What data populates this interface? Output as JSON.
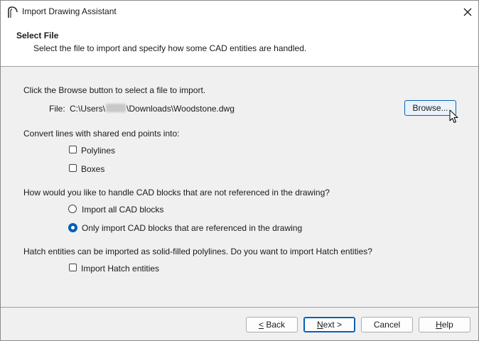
{
  "window": {
    "title": "Import Drawing Assistant"
  },
  "header": {
    "title": "Select File",
    "description": "Select the file to import and specify how some CAD entities are handled."
  },
  "file_section": {
    "instruction": "Click the Browse button to select a file to import.",
    "file_label": "File:",
    "file_path_prefix": "C:\\Users\\",
    "file_path_suffix": "\\Downloads\\Woodstone.dwg",
    "browse_label": "Browse..."
  },
  "lines_section": {
    "question": "Convert lines with shared end points into:",
    "options": [
      {
        "label": "Polylines",
        "checked": false
      },
      {
        "label": "Boxes",
        "checked": false
      }
    ]
  },
  "blocks_section": {
    "question": "How would you like to handle CAD blocks that are not referenced in the drawing?",
    "options": [
      {
        "label": "Import all CAD blocks",
        "selected": false
      },
      {
        "label": "Only import CAD blocks that are referenced in the drawing",
        "selected": true
      }
    ]
  },
  "hatch_section": {
    "question": "Hatch entities can be imported as solid-filled polylines. Do you want to import Hatch entities?",
    "option": {
      "label": "Import Hatch entities",
      "checked": false
    }
  },
  "footer": {
    "back": {
      "accel": "<",
      "rest": " Back"
    },
    "next": {
      "accel": "N",
      "rest": "ext >"
    },
    "cancel": "Cancel",
    "help": {
      "accel": "H",
      "rest": "elp"
    }
  },
  "colors": {
    "accent": "#005fb8",
    "window_bg": "#f0f0f0",
    "header_bg": "#ffffff"
  },
  "icons": [
    "app-icon",
    "close-icon",
    "mouse-cursor-icon"
  ]
}
